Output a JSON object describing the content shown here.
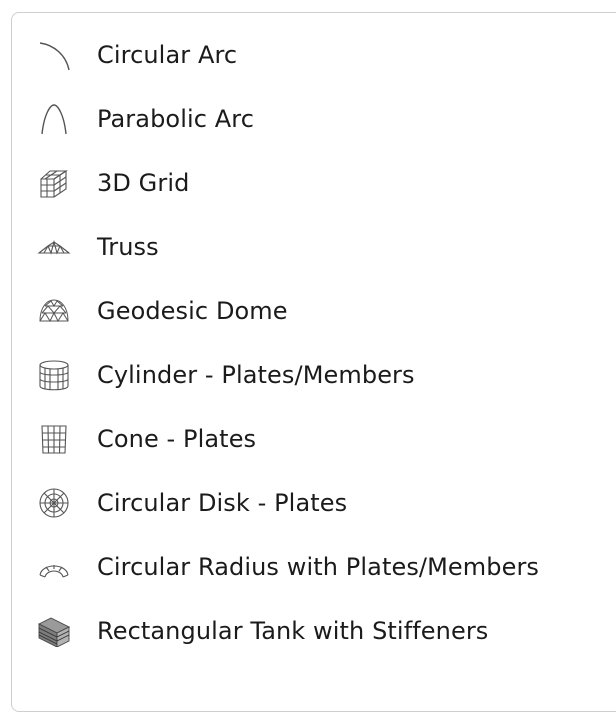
{
  "menu": {
    "items": [
      {
        "label": "Circular Arc",
        "icon": "circular-arc-icon"
      },
      {
        "label": "Parabolic Arc",
        "icon": "parabolic-arc-icon"
      },
      {
        "label": "3D Grid",
        "icon": "3d-grid-icon"
      },
      {
        "label": "Truss",
        "icon": "truss-icon"
      },
      {
        "label": "Geodesic Dome",
        "icon": "geodesic-dome-icon"
      },
      {
        "label": "Cylinder - Plates/Members",
        "icon": "cylinder-icon"
      },
      {
        "label": "Cone - Plates",
        "icon": "cone-icon"
      },
      {
        "label": "Circular Disk - Plates",
        "icon": "circular-disk-icon"
      },
      {
        "label": "Circular Radius with Plates/Members",
        "icon": "circular-radius-icon"
      },
      {
        "label": "Rectangular Tank with Stiffeners",
        "icon": "rectangular-tank-icon"
      }
    ]
  }
}
